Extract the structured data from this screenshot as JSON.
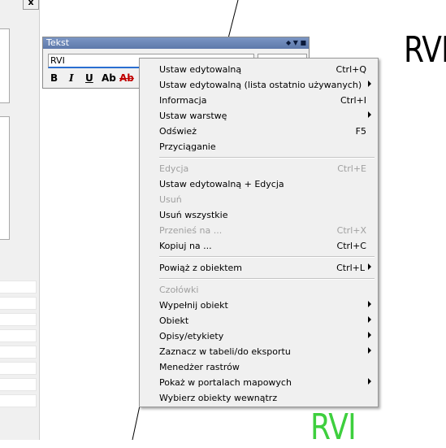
{
  "text_toolbar": {
    "title": "Tekst",
    "input_value": "RVI",
    "format_buttons": {
      "bold": "B",
      "italic": "I",
      "underline": "U",
      "ab1": "Ab",
      "ab2": "Ab"
    }
  },
  "canvas": {
    "label_black": "RVI",
    "label_green": "RVI",
    "green_color": "#3ecf3e"
  },
  "left_panel": {
    "close_label": "x"
  },
  "menu": {
    "items": [
      {
        "label": "Ustaw edytowalną",
        "shortcut": "Ctrl+Q",
        "submenu": false,
        "disabled": false
      },
      {
        "label": "Ustaw edytowalną (lista ostatnio używanych)",
        "shortcut": "",
        "submenu": true,
        "disabled": false
      },
      {
        "label": "Informacja",
        "shortcut": "Ctrl+I",
        "submenu": false,
        "disabled": false
      },
      {
        "label": "Ustaw warstwę",
        "shortcut": "",
        "submenu": true,
        "disabled": false
      },
      {
        "label": "Odśwież",
        "shortcut": "F5",
        "submenu": false,
        "disabled": false
      },
      {
        "label": "Przyciąganie",
        "shortcut": "",
        "submenu": false,
        "disabled": false
      },
      {
        "label": "Edycja",
        "shortcut": "Ctrl+E",
        "submenu": false,
        "disabled": true
      },
      {
        "label": "Ustaw edytowalną + Edycja",
        "shortcut": "",
        "submenu": false,
        "disabled": false
      },
      {
        "label": "Usuń",
        "shortcut": "",
        "submenu": false,
        "disabled": true
      },
      {
        "label": "Usuń wszystkie",
        "shortcut": "",
        "submenu": false,
        "disabled": false
      },
      {
        "label": "Przenieś na ...",
        "shortcut": "Ctrl+X",
        "submenu": false,
        "disabled": true
      },
      {
        "label": "Kopiuj na ...",
        "shortcut": "Ctrl+C",
        "submenu": false,
        "disabled": false
      },
      {
        "label": "Powiąż z obiektem",
        "shortcut": "Ctrl+L",
        "submenu": true,
        "disabled": false
      },
      {
        "label": "Czołówki",
        "shortcut": "",
        "submenu": false,
        "disabled": true
      },
      {
        "label": "Wypełnij obiekt",
        "shortcut": "",
        "submenu": true,
        "disabled": false
      },
      {
        "label": "Obiekt",
        "shortcut": "",
        "submenu": true,
        "disabled": false
      },
      {
        "label": "Opisy/etykiety",
        "shortcut": "",
        "submenu": true,
        "disabled": false
      },
      {
        "label": "Zaznacz w tabeli/do eksportu",
        "shortcut": "",
        "submenu": true,
        "disabled": false
      },
      {
        "label": "Menedżer rastrów",
        "shortcut": "",
        "submenu": false,
        "disabled": false
      },
      {
        "label": "Pokaż w portalach mapowych",
        "shortcut": "",
        "submenu": true,
        "disabled": false
      },
      {
        "label": "Wybierz obiekty wewnątrz",
        "shortcut": "",
        "submenu": false,
        "disabled": false
      }
    ]
  }
}
